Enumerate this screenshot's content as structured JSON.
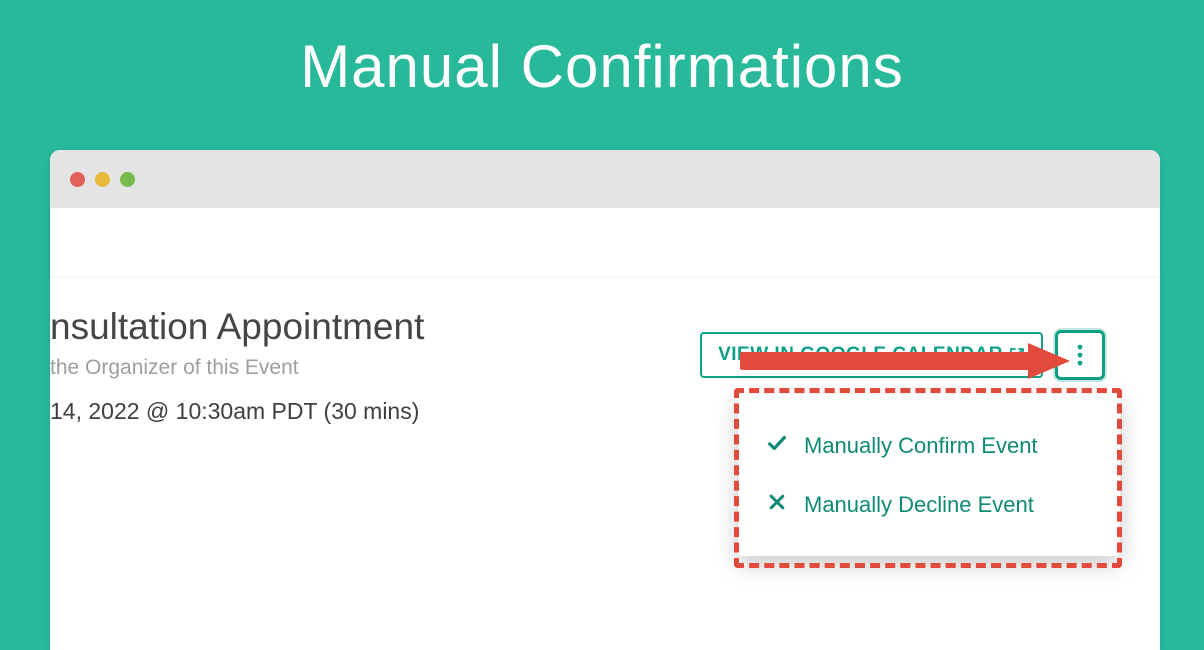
{
  "title": "Manual Confirmations",
  "event": {
    "title_partial": "nsultation Appointment",
    "organizer_partial": "the Organizer of this Event",
    "date_partial": "14, 2022 @ 10:30am PDT (30 mins)"
  },
  "actions": {
    "view_label": "VIEW IN GOOGLE CALENDAR"
  },
  "menu": {
    "confirm": "Manually Confirm Event",
    "decline": "Manually Decline Event"
  }
}
